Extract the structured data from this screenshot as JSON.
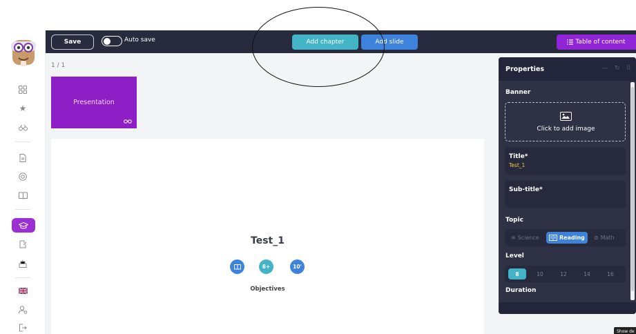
{
  "toolbar": {
    "save_label": "Save",
    "autosave_label": "Auto save",
    "autosave_on": false,
    "add_chapter_label": "Add chapter",
    "add_slide_label": "Add slide",
    "toc_label": "Table of content",
    "toc_icon": "list-icon"
  },
  "sidebar": {
    "icons": [
      "grid-icon",
      "star-icon",
      "binoculars-icon",
      "document-icon",
      "support-icon",
      "book-icon",
      "graduation-cap-icon",
      "note-icon",
      "certificate-icon",
      "uk-flag-icon",
      "user-settings-icon",
      "logout-icon"
    ],
    "active_item": "graduation-cap-icon"
  },
  "slides": {
    "pager": "1 / 1",
    "thumbnail_label": "Presentation"
  },
  "slide": {
    "title": "Test_1",
    "badges": [
      {
        "icon": "book-icon",
        "text": "",
        "color": "#3d83dd"
      },
      {
        "icon": "",
        "text": "8+",
        "color": "#43b3c6"
      },
      {
        "icon": "",
        "text": "10'",
        "color": "#3d83dd"
      }
    ],
    "objectives_label": "Objectives"
  },
  "properties": {
    "title": "Properties",
    "banner_label": "Banner",
    "banner_placeholder": "Click to add image",
    "title_label": "Title*",
    "title_value": "Test_1",
    "subtitle_label": "Sub-title*",
    "subtitle_value": "",
    "topic_label": "Topic",
    "topics": [
      "Science",
      "Reading",
      "Math"
    ],
    "active_topic": "Reading",
    "level_label": "Level",
    "levels": [
      "8",
      "10",
      "12",
      "14",
      "16"
    ],
    "active_level": "8",
    "duration_label": "Duration"
  },
  "tooltip": "Show de",
  "colors": {
    "toolbar_bg": "#272b3d",
    "accent_purple": "#8f25d6",
    "accent_teal": "#43b3c6",
    "accent_blue": "#3d83dd"
  }
}
